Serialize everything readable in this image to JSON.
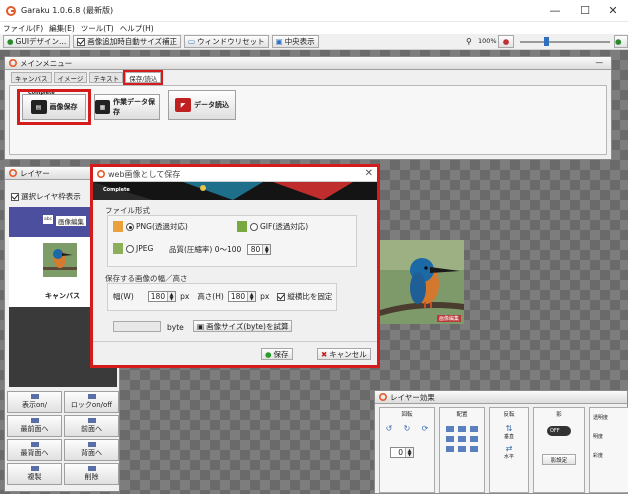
{
  "app": {
    "title": "Garaku 1.0.6.8 (最新版)",
    "window_controls": {
      "minimize": "—",
      "maximize": "☐",
      "close": "✕"
    }
  },
  "menubar": [
    "ファイル(F)",
    "編集(E)",
    "ツール(T)",
    "ヘルプ(H)"
  ],
  "toolbar": {
    "gui_design": "GUIデザイン...",
    "auto_resize": "画像追加時自動サイズ補正",
    "auto_resize_checked": true,
    "window_reset": "ウィンドウリセット",
    "center_display": "中央表示",
    "zoom": "100%"
  },
  "main_menu": {
    "title": "メインメニュー",
    "tabs": [
      "キャンバス",
      "イメージ",
      "テキスト",
      "保存/読込"
    ],
    "active_tab": 3,
    "buttons": {
      "image_save": "画像保存",
      "image_save_badge": "Complete",
      "work_data_save": "作業データ保存",
      "data_load": "データ読込"
    }
  },
  "layer_panel": {
    "title": "レイヤー",
    "select_frame_label": "選択レイヤ枠表示",
    "select_frame_checked": true,
    "layers": [
      {
        "label": "画像編集",
        "badge": "abc"
      },
      {
        "label": "キャンバス"
      }
    ],
    "buttons": [
      "表示on/",
      "ロックon/off",
      "最前面へ",
      "前面へ",
      "最背面へ",
      "背面へ",
      "複製",
      "削除"
    ]
  },
  "canvas_image_label": "画像編集",
  "dialog": {
    "title": "web画像として保存",
    "file_format_label": "ファイル形式",
    "formats": [
      {
        "label": "PNG(透過対応)",
        "selected": true
      },
      {
        "label": "GIF(透過対応)",
        "selected": false
      },
      {
        "label": "JPEG",
        "selected": false
      }
    ],
    "quality_label": "品質(圧縮率) 0～100",
    "quality_value": "80",
    "size_label": "保存する画像の幅／高さ",
    "width_label": "幅(W)",
    "width_value": "180",
    "height_label": "高さ(H)",
    "height_value": "180",
    "unit": "px",
    "keep_ratio_label": "縦横比を固定",
    "keep_ratio_checked": true,
    "byte_unit": "byte",
    "estimate_button": "画像サイズ(byte)を試算",
    "save_button": "保存",
    "cancel_button": "キャンセル"
  },
  "layer_effect": {
    "title": "レイヤー効果",
    "sections": [
      "回転",
      "配置",
      "反転",
      "影"
    ],
    "rotation_value": "0",
    "shadow_toggle": "OFF",
    "shadow_settings": "影設定",
    "flip_labels": [
      "垂直",
      "水平"
    ],
    "params": [
      "透明度",
      "明度",
      "彩度"
    ]
  },
  "colors": {
    "highlight_red": "#d41c1c",
    "layer_selected": "#4b4f9e"
  }
}
